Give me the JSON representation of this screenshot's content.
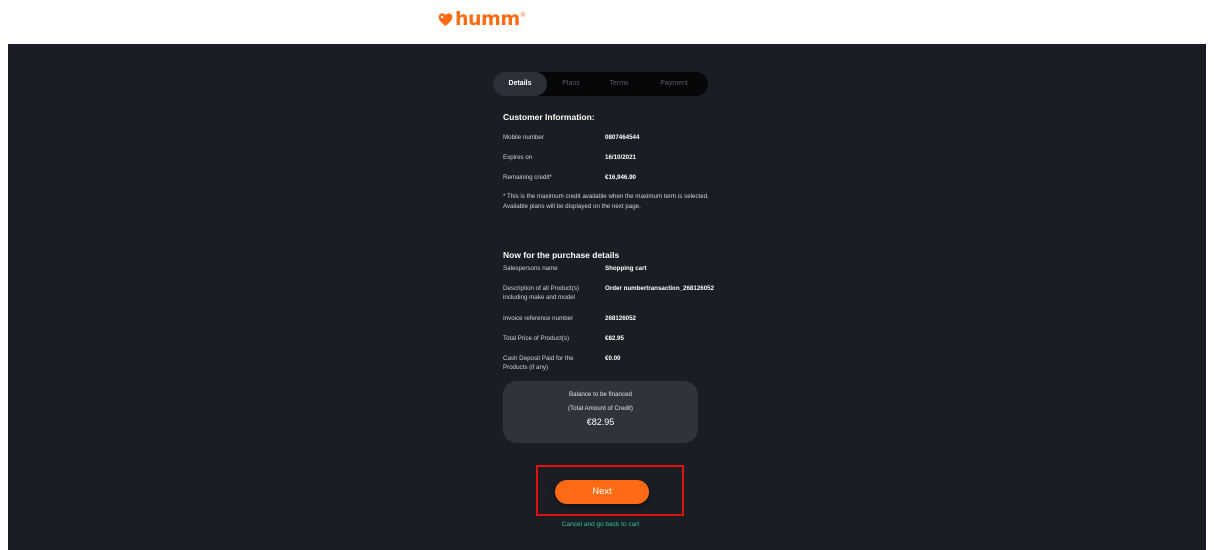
{
  "brand": {
    "name": "humm",
    "tm": "®",
    "color": "#ff6a13"
  },
  "tabs": [
    {
      "label": "Details",
      "active": true
    },
    {
      "label": "Plans",
      "active": false
    },
    {
      "label": "Terms",
      "active": false
    },
    {
      "label": "Payment",
      "active": false
    }
  ],
  "customer": {
    "heading": "Customer Information:",
    "rows": [
      {
        "label": "Mobile number",
        "value": "0807464544"
      },
      {
        "label": "Expires on",
        "value": "16/10/2021"
      },
      {
        "label": "Remaining credit*",
        "value": "€16,946.90"
      }
    ],
    "note": "* This is the maximum credit available when the maximum term is selected. Available plans will be displayed on the next page."
  },
  "purchase": {
    "heading": "Now for the purchase details",
    "rows": [
      {
        "label": "Salespersons name",
        "value": "Shopping cart"
      },
      {
        "label": "Description of all Product(s) including make and model",
        "value": "Order numbertransaction_268126052"
      },
      {
        "label": "Invoice reference number",
        "value": "268126052"
      },
      {
        "label": "Total Price of Product(s)",
        "value": "€82.95"
      },
      {
        "label": "Cash Deposit Paid for the Products (if any)",
        "value": "€0.00"
      }
    ]
  },
  "balance": {
    "line1": "Balance to be financed",
    "line2": "(Total Amount of Credit)",
    "amount": "€82.95"
  },
  "actions": {
    "next_label": "Next",
    "cancel_label": "Cancel and go back to cart"
  },
  "colors": {
    "accent": "#ff6a13",
    "link": "#2ec5a0",
    "background": "#1a1d23",
    "highlight": "#e01010"
  }
}
